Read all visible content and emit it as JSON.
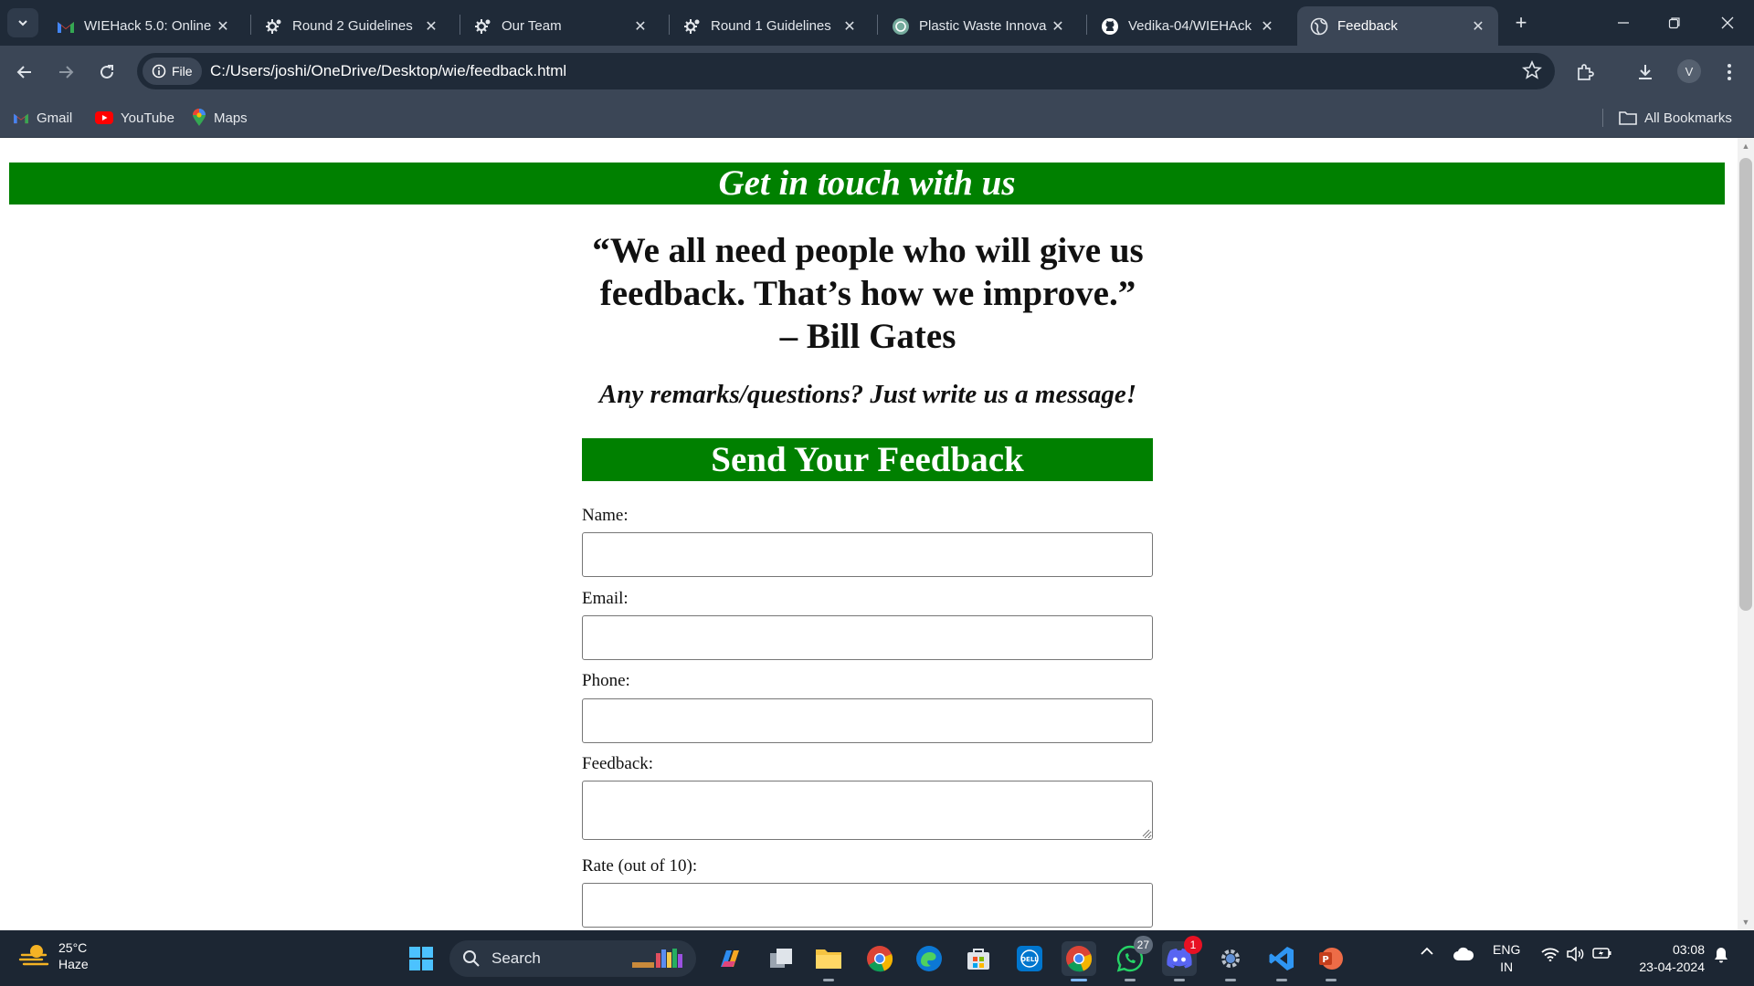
{
  "browser": {
    "tabs": [
      {
        "title": "WIEHack 5.0: Online",
        "icon": "gmail-icon"
      },
      {
        "title": "Round 2 Guidelines",
        "icon": "gear-people-icon"
      },
      {
        "title": "Our Team",
        "icon": "gear-people-icon"
      },
      {
        "title": "Round 1 Guidelines",
        "icon": "gear-people-icon"
      },
      {
        "title": "Plastic Waste Innova",
        "icon": "chatgpt-icon"
      },
      {
        "title": "Vedika-04/WIEHAck",
        "icon": "github-icon"
      },
      {
        "title": "Feedback",
        "icon": "globe-icon",
        "active": true
      }
    ],
    "address": {
      "chip": "File",
      "url": "C:/Users/joshi/OneDrive/Desktop/wie/feedback.html"
    },
    "profile_initial": "V",
    "bookmarks": [
      {
        "label": "Gmail",
        "icon": "gmail-icon"
      },
      {
        "label": "YouTube",
        "icon": "youtube-icon"
      },
      {
        "label": "Maps",
        "icon": "maps-icon"
      }
    ],
    "all_bookmarks": "All Bookmarks"
  },
  "page": {
    "banner": "Get in touch with us",
    "quote_lines": [
      "“We all need people who will give us",
      "feedback. That’s how we improve.”",
      "– Bill Gates"
    ],
    "remarks": "Any remarks/questions? Just write us a message!",
    "form": {
      "heading": "Send Your Feedback",
      "fields": [
        {
          "label": "Name:",
          "value": ""
        },
        {
          "label": "Email:",
          "value": ""
        },
        {
          "label": "Phone:",
          "value": ""
        },
        {
          "label": "Feedback:",
          "value": ""
        },
        {
          "label": "Rate (out of 10):",
          "value": ""
        }
      ]
    }
  },
  "taskbar": {
    "weather": {
      "temp": "25°C",
      "condition": "Haze"
    },
    "search_label": "Search",
    "whatsapp_badge": "27",
    "discord_badge": "1",
    "language": {
      "lang": "ENG",
      "region": "IN"
    },
    "clock": {
      "time": "03:08",
      "date": "23-04-2024"
    }
  },
  "colors": {
    "banner_green": "#008000",
    "chrome_dark": "#1f2a38",
    "chrome_mid": "#3b4656"
  }
}
